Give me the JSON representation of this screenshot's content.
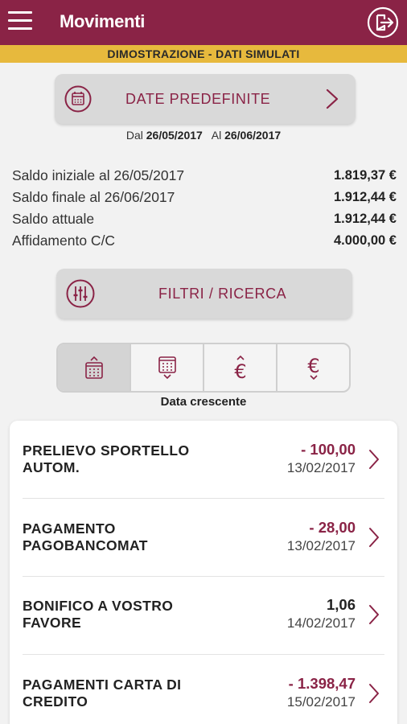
{
  "appbar": {
    "title": "Movimenti",
    "menu_icon": "hamburger-menu-icon",
    "logout_icon": "logout-icon"
  },
  "demo_banner": "DIMOSTRAZIONE - DATI SIMULATI",
  "date_button": {
    "label": "DATE PREDEFINITE",
    "icon": "calendar-icon"
  },
  "range": {
    "from_label": "Dal",
    "from": "26/05/2017",
    "to_label": "Al",
    "to": "26/06/2017"
  },
  "summary": [
    {
      "label": "Saldo iniziale al 26/05/2017",
      "value": "1.819,37 €"
    },
    {
      "label": "Saldo finale al 26/06/2017",
      "value": "1.912,44 €"
    },
    {
      "label": "Saldo attuale",
      "value": "1.912,44 €"
    },
    {
      "label": "Affidamento C/C",
      "value": "4.000,00 €"
    }
  ],
  "filter_button": {
    "label": "FILTRI / RICERCA",
    "icon": "sliders-icon"
  },
  "sort": {
    "options": [
      "calendar-ascending-icon",
      "calendar-descending-icon",
      "euro-ascending-icon",
      "euro-descending-icon"
    ],
    "active_index": 0,
    "label": "Data crescente"
  },
  "transactions": [
    {
      "desc_line1": "PRELIEVO SPORTELLO",
      "desc_line2": "AUTOM.",
      "amount": "- 100,00",
      "date": "13/02/2017",
      "negative": true
    },
    {
      "desc_line1": "PAGAMENTO",
      "desc_line2": "PAGOBANCOMAT",
      "amount": "- 28,00",
      "date": "13/02/2017",
      "negative": true
    },
    {
      "desc_line1": "BONIFICO A VOSTRO",
      "desc_line2": "FAVORE",
      "amount": "1,06",
      "date": "14/02/2017",
      "negative": false
    },
    {
      "desc_line1": "PAGAMENTI CARTA DI",
      "desc_line2": "CREDITO",
      "amount": "- 1.398,47",
      "date": "15/02/2017",
      "negative": true
    }
  ],
  "colors": {
    "brand": "#8a2346",
    "banner": "#e7b93d",
    "button_bg": "#d9d9d9",
    "background": "#f2f2f2"
  }
}
